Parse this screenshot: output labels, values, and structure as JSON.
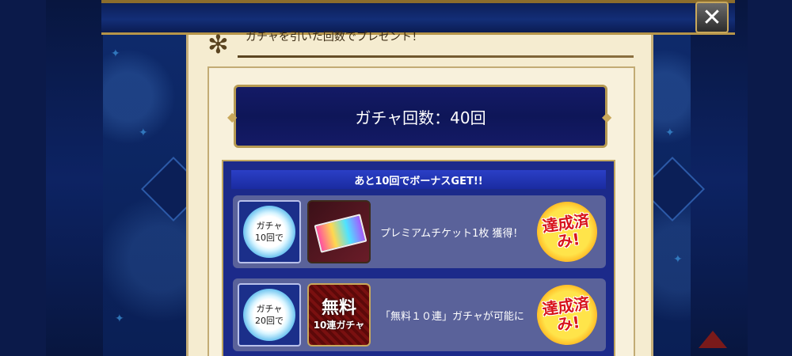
{
  "header": {
    "title": "ガチャを引いた回数でプレゼント！",
    "close_label": "✕"
  },
  "counter": {
    "text": "ガチャ回数：40回"
  },
  "bonus": {
    "header": "あと10回でボーナスGET!!",
    "rewards": [
      {
        "badge_line1": "ガチャ",
        "badge_line2": "10回で",
        "description": "プレミアムチケット1枚 獲得！",
        "stamp": "達成済み!",
        "icon": "premium-ticket-icon"
      },
      {
        "badge_line1": "ガチャ",
        "badge_line2": "20回で",
        "description": "「無料１０連」ガチャが可能に",
        "stamp": "達成済み!",
        "icon": "free-10-gacha-icon",
        "icon_text_top": "無料",
        "icon_text_bottom": "10連ガチャ"
      }
    ]
  },
  "colors": {
    "navy": "#0e1658",
    "gold": "#c9a85b",
    "parchment": "#f5ecd0",
    "stamp_red": "#d8141c",
    "stamp_yellow": "#ffe44a"
  }
}
